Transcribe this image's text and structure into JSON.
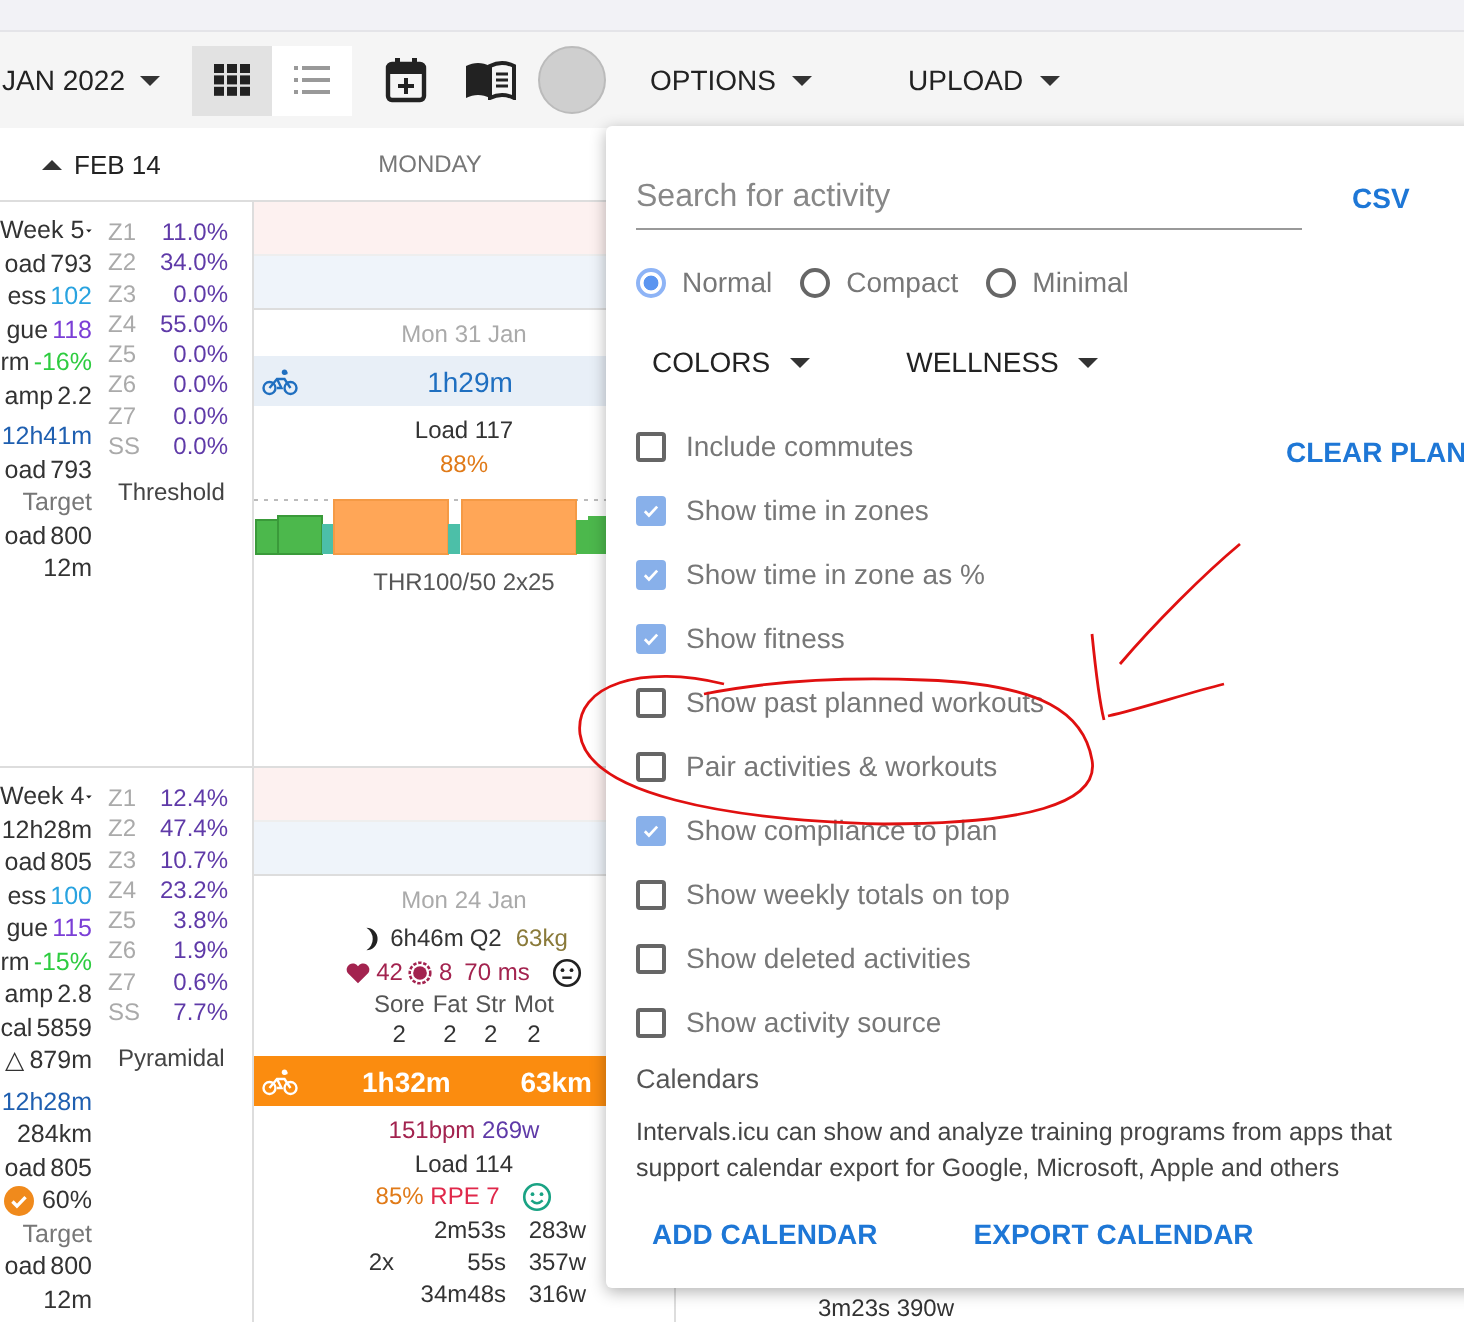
{
  "toolbar": {
    "date_label": "JAN 2022",
    "view_buttons": [
      {
        "kind": "grid",
        "selected": true
      },
      {
        "kind": "list",
        "selected": false
      }
    ],
    "menus": [
      {
        "label": "OPTIONS"
      },
      {
        "label": "UPLOAD"
      }
    ]
  },
  "header": {
    "week_label": "FEB 14",
    "day_label": "MONDAY"
  },
  "weeks": [
    {
      "title": "Week 5",
      "stats": [
        {
          "label": "oad",
          "value": "793"
        },
        {
          "label": "ess",
          "value": "102",
          "color": "#29a3e0"
        },
        {
          "label": "gue",
          "value": "118",
          "color": "#7b3fd6"
        },
        {
          "label": "rm",
          "value": "-16%",
          "color": "#2ecc40"
        },
        {
          "label": "amp",
          "value": "2.2"
        }
      ],
      "totals": [
        {
          "value": "12h41m",
          "color": "#1f5fb0"
        },
        {
          "label": "oad",
          "value": "793"
        },
        {
          "label": "Target",
          "color": "#777777"
        },
        {
          "label": "oad",
          "value": "800"
        },
        {
          "value": "12m"
        }
      ],
      "zones": [
        {
          "zone": "Z1",
          "pct": "11.0%"
        },
        {
          "zone": "Z2",
          "pct": "34.0%"
        },
        {
          "zone": "Z3",
          "pct": "0.0%"
        },
        {
          "zone": "Z4",
          "pct": "55.0%"
        },
        {
          "zone": "Z5",
          "pct": "0.0%"
        },
        {
          "zone": "Z6",
          "pct": "0.0%"
        },
        {
          "zone": "Z7",
          "pct": "0.0%"
        },
        {
          "zone": "SS",
          "pct": "0.0%"
        }
      ],
      "distribution": "Threshold",
      "day": {
        "date": "Mon 31 Jan",
        "planned": {
          "duration": "1h29m",
          "load": "Load 117",
          "compliance": "88%",
          "name": "THR100/50 2x25"
        }
      }
    },
    {
      "title": "Week 4",
      "stats": [
        {
          "value": "12h28m"
        },
        {
          "label": "oad",
          "value": "805"
        },
        {
          "label": "ess",
          "value": "100",
          "color": "#29a3e0"
        },
        {
          "label": "gue",
          "value": "115",
          "color": "#7b3fd6"
        },
        {
          "label": "rm",
          "value": "-15%",
          "color": "#2ecc40"
        },
        {
          "label": "amp",
          "value": "2.8"
        },
        {
          "label": "cal",
          "value": "5859"
        },
        {
          "label": "△",
          "value": "879m"
        }
      ],
      "totals": [
        {
          "value": "12h28m",
          "color": "#1f5fb0"
        },
        {
          "value": "284km"
        },
        {
          "label": "oad",
          "value": "805"
        },
        {
          "value": "60%",
          "kind": "compliance"
        },
        {
          "label": "Target",
          "color": "#777777"
        },
        {
          "label": "oad",
          "value": "800"
        },
        {
          "value": "12m"
        }
      ],
      "zones": [
        {
          "zone": "Z1",
          "pct": "12.4%"
        },
        {
          "zone": "Z2",
          "pct": "47.4%"
        },
        {
          "zone": "Z3",
          "pct": "10.7%"
        },
        {
          "zone": "Z4",
          "pct": "23.2%"
        },
        {
          "zone": "Z5",
          "pct": "3.8%"
        },
        {
          "zone": "Z6",
          "pct": "1.9%"
        },
        {
          "zone": "Z7",
          "pct": "0.6%"
        },
        {
          "zone": "SS",
          "pct": "7.7%"
        }
      ],
      "distribution": "Pyramidal",
      "day": {
        "date": "Mon 24 Jan",
        "wellness": {
          "sleep": "6h46m",
          "quality": "Q2",
          "weight": "63kg",
          "resting_hr": "42",
          "hrv": "8",
          "hrv_ms": "70 ms",
          "scores": [
            {
              "label": "Sore",
              "value": "2"
            },
            {
              "label": "Fat",
              "value": "2"
            },
            {
              "label": "Str",
              "value": "2"
            },
            {
              "label": "Mot",
              "value": "2"
            }
          ]
        },
        "activity": {
          "duration": "1h32m",
          "distance": "63km",
          "heart_rate": "151bpm",
          "power": "269w",
          "load": "Load 114",
          "intensity": "85%",
          "rpe": "RPE 7",
          "intervals": [
            {
              "time": "2m53s",
              "power": "283w"
            },
            {
              "reps": "2x",
              "time": "55s",
              "power": "357w"
            },
            {
              "time": "34m48s",
              "power": "316w"
            }
          ]
        }
      }
    }
  ],
  "next_column": {
    "lines": [
      "3m23s 390w"
    ]
  },
  "options_menu": {
    "search": {
      "placeholder": "Search for activity"
    },
    "csv_link": "CSV",
    "layouts": [
      {
        "label": "Normal",
        "selected": true
      },
      {
        "label": "Compact",
        "selected": false
      },
      {
        "label": "Minimal",
        "selected": false
      }
    ],
    "dropdowns": [
      {
        "label": "COLORS"
      },
      {
        "label": "WELLNESS"
      }
    ],
    "clear_plan": "CLEAR PLAN",
    "checkboxes": [
      {
        "label": "Include commutes",
        "checked": false
      },
      {
        "label": "Show time in zones",
        "checked": true
      },
      {
        "label": "Show time in zone as %",
        "checked": true
      },
      {
        "label": "Show fitness",
        "checked": true
      },
      {
        "label": "Show past planned workouts",
        "checked": false
      },
      {
        "label": "Pair activities & workouts",
        "checked": false
      },
      {
        "label": "Show compliance to plan",
        "checked": true
      },
      {
        "label": "Show weekly totals on top",
        "checked": false
      },
      {
        "label": "Show deleted activities",
        "checked": false
      },
      {
        "label": "Show activity source",
        "checked": false
      }
    ],
    "calendars": {
      "title": "Calendars",
      "description": "Intervals.icu can show and analyze training programs from apps that support calendar export for Google, Microsoft, Apple and others",
      "buttons": [
        "ADD CALENDAR",
        "EXPORT CALENDAR"
      ]
    }
  }
}
